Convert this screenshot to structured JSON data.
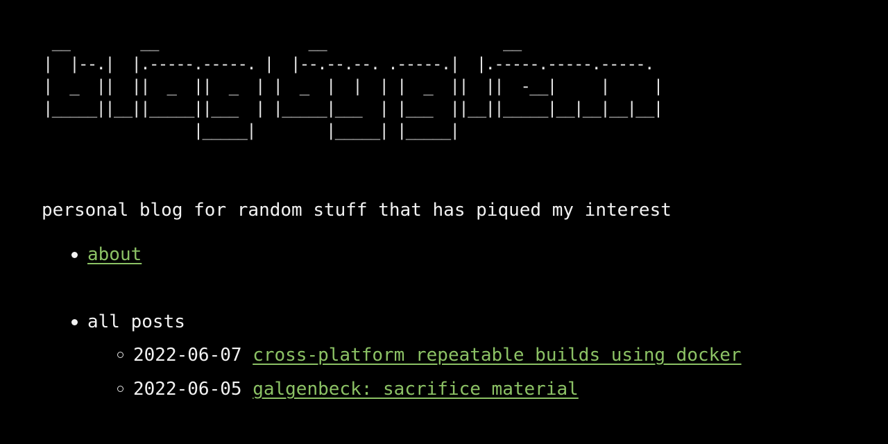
{
  "header": {
    "ascii_title": " __        __                 __                    __\n|  |--.|  |.-----.-----. |  |--.--.--. .-----.|  |.-----.-----.-----.\n|  _  ||  ||  _  ||  _  | |  _  |  |  | |  _  ||  ||  -__|     |     |\n|_____||__||_____||___  | |_____|___  | |___  ||__||_____|__|__|__|__|\n                 |_____|        |_____| |_____|"
  },
  "tagline": "personal blog for random stuff that has piqued my interest",
  "nav": {
    "about_label": "about"
  },
  "posts": {
    "heading": "all posts",
    "items": [
      {
        "date": "2022-06-07",
        "title": "cross-platform repeatable builds using docker"
      },
      {
        "date": "2022-06-05",
        "title": "galgenbeck: sacrifice material"
      }
    ]
  },
  "colors": {
    "background": "#000000",
    "text": "#f2f2f2",
    "link": "#8cc265"
  }
}
